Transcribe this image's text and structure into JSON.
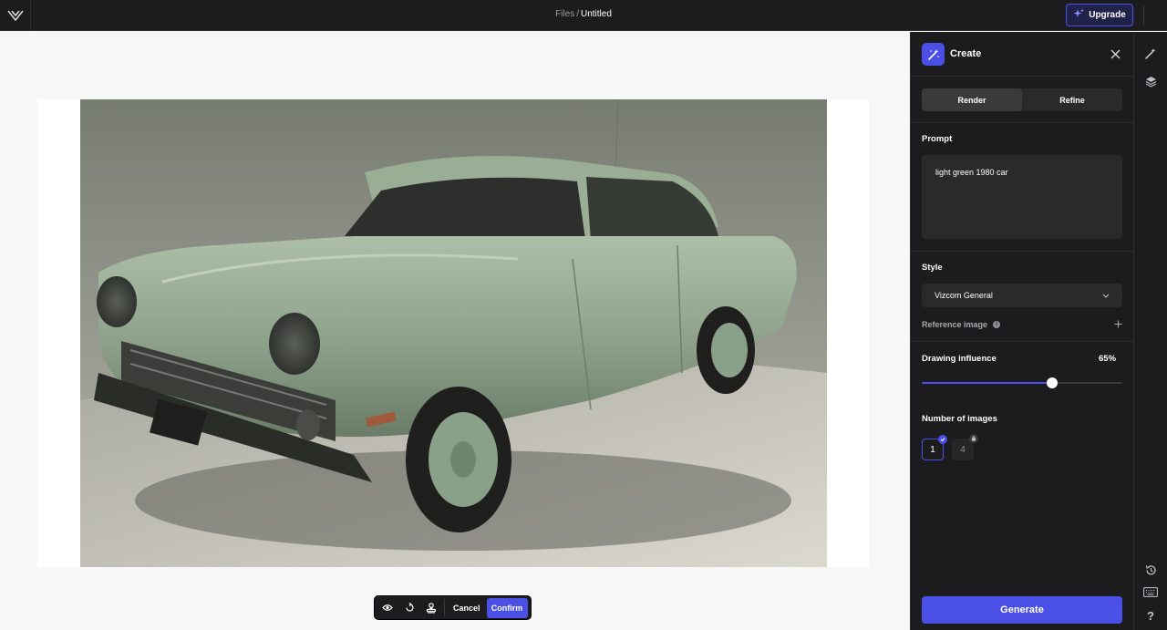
{
  "topbar": {
    "logo_icon": "vizcom-logo-icon",
    "breadcrumb_root": "Files",
    "breadcrumb_sep": "/",
    "breadcrumb_title": "Untitled",
    "upgrade_label": "Upgrade",
    "upgrade_icon": "sparkle-icon"
  },
  "canvas": {
    "image_alt": "light green 1980 car render"
  },
  "floating_toolbar": {
    "icons": [
      "eye-icon",
      "reset-icon",
      "stamp-icon"
    ],
    "cancel_label": "Cancel",
    "confirm_label": "Confirm"
  },
  "panel": {
    "title": "Create",
    "title_icon": "magic-wand-icon",
    "tabs": [
      {
        "label": "Render",
        "active": true
      },
      {
        "label": "Refine",
        "active": false
      }
    ],
    "prompt_label": "Prompt",
    "prompt_value": "light green 1980 car",
    "style_label": "Style",
    "style_value": "Vizcom General",
    "reference_label": "Reference image",
    "influence_label": "Drawing influence",
    "influence_value": "65%",
    "influence_fraction": 0.65,
    "images_label": "Number of images",
    "image_counts": [
      {
        "label": "1",
        "selected": true,
        "locked": false
      },
      {
        "label": "4",
        "selected": false,
        "locked": true
      }
    ],
    "generate_label": "Generate"
  },
  "rail": {
    "icons": [
      "magic-wand-icon",
      "layers-icon",
      "history-icon",
      "keyboard-icon",
      "help-icon"
    ],
    "help_label": "?"
  },
  "colors": {
    "accent": "#4a50e6",
    "panel_bg": "#1c1c1e",
    "canvas_bg": "#f7f7f7",
    "car_green": "#8fa38f"
  }
}
